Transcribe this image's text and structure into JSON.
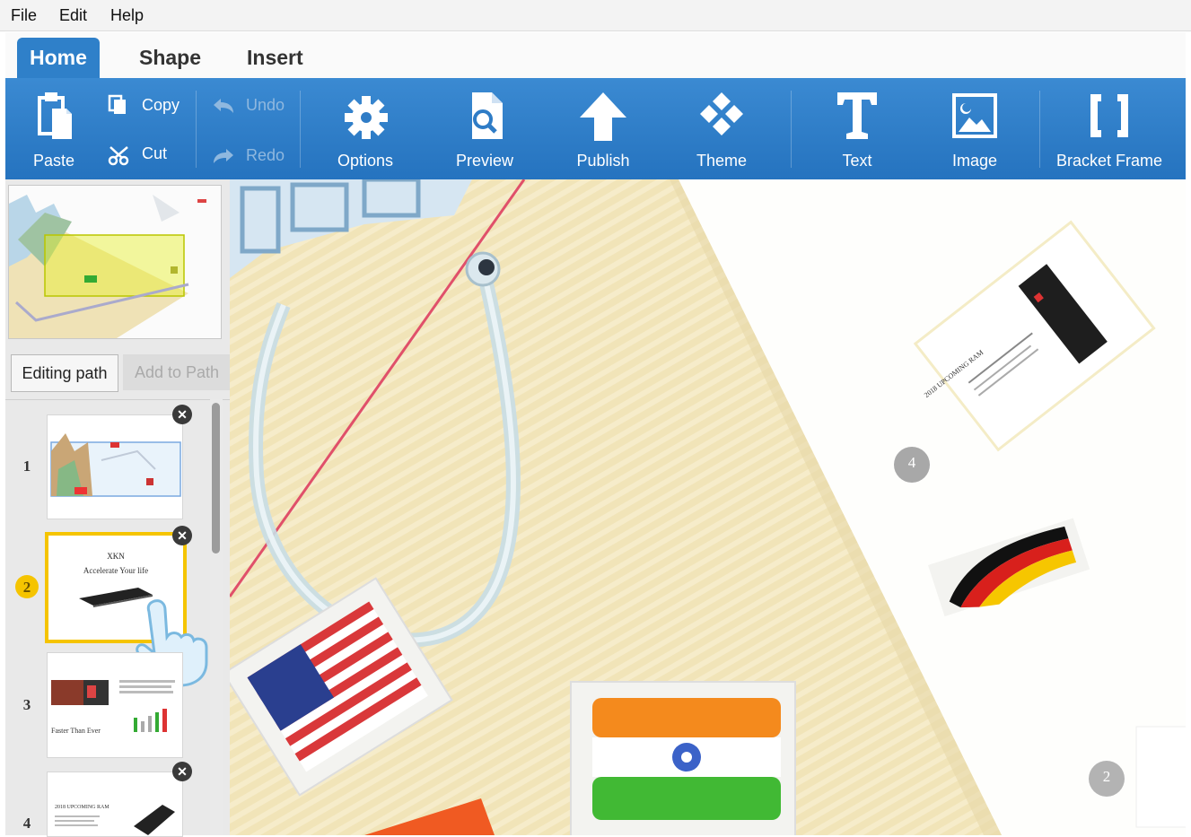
{
  "menu": {
    "file": "File",
    "edit": "Edit",
    "help": "Help"
  },
  "tabs": [
    {
      "label": "Home"
    },
    {
      "label": "Shape"
    },
    {
      "label": "Insert"
    }
  ],
  "ribbon": {
    "paste": "Paste",
    "copy": "Copy",
    "cut": "Cut",
    "undo": "Undo",
    "redo": "Redo",
    "options": "Options",
    "preview": "Preview",
    "publish": "Publish",
    "theme": "Theme",
    "text": "Text",
    "image": "Image",
    "bracket_frame": "Bracket Frame"
  },
  "sidebar": {
    "editing_path": "Editing path",
    "add_to_path": "Add to Path",
    "slides": [
      {
        "number": "1",
        "selected": false
      },
      {
        "number": "2",
        "selected": true,
        "title": "XKN",
        "subtitle": "Accelerate Your life"
      },
      {
        "number": "3",
        "selected": false,
        "caption": "Faster Than Ever"
      },
      {
        "number": "4",
        "selected": false,
        "title": "2018 UPCOMING RAM"
      }
    ]
  },
  "canvas": {
    "markers": [
      "4",
      "2"
    ],
    "card_title": "2018 UPCOMING RAM"
  },
  "colors": {
    "accent": "#2f80c9",
    "selection": "#f5c400",
    "path_line": "#e0506a"
  }
}
